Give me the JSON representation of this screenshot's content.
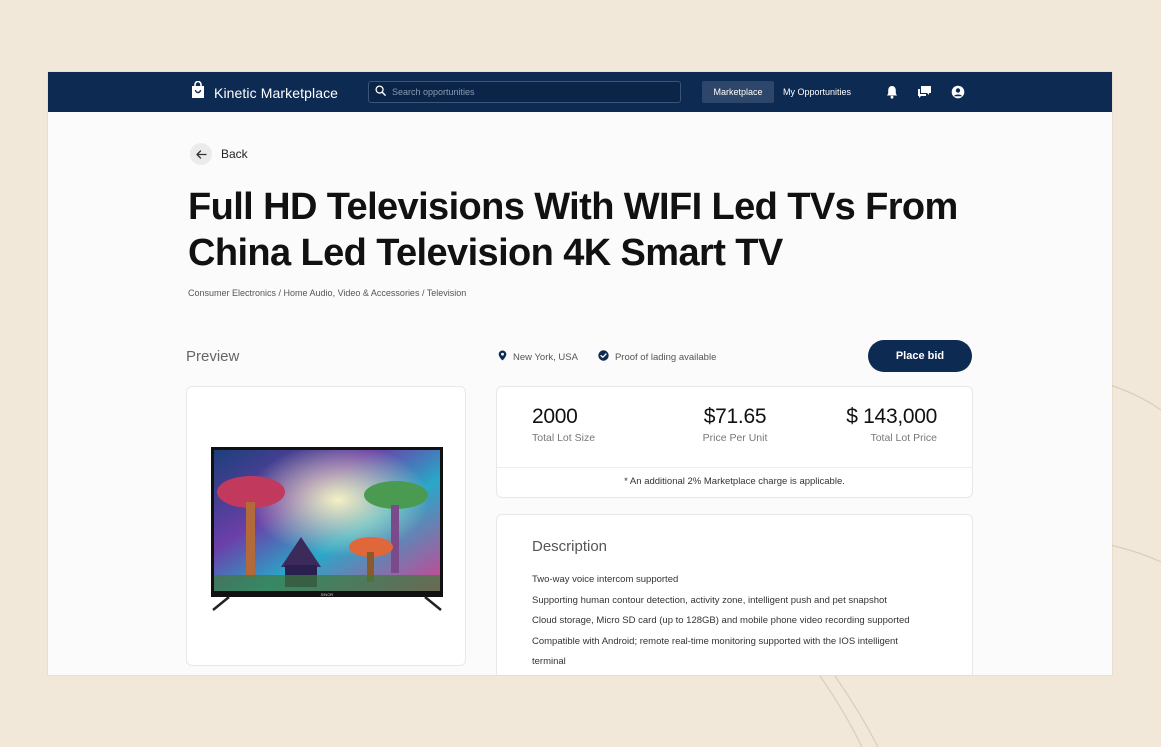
{
  "app": {
    "name": "Kinetic Marketplace"
  },
  "search": {
    "placeholder": "Search opportunities"
  },
  "nav": {
    "marketplace": "Marketplace",
    "my_opportunities": "My Opportunities"
  },
  "icons": {
    "logo": "shopping-bag-icon",
    "search": "search-icon",
    "notifications": "bell-icon",
    "messages": "chat-icon",
    "account": "user-circle-icon",
    "back": "arrow-left-icon",
    "location": "location-pin-icon",
    "verified": "check-circle-icon"
  },
  "back": {
    "label": "Back"
  },
  "product": {
    "title": "Full HD Televisions With WIFI Led TVs From China Led Television 4K Smart TV",
    "breadcrumb": "Consumer Electronics / Home Audio, Video & Accessories /  Television",
    "location": "New York, USA",
    "proof": "Proof of lading available",
    "tv_brand": "SINOR"
  },
  "preview": {
    "label": "Preview"
  },
  "actions": {
    "place_bid": "Place bid"
  },
  "stats": {
    "lot_size": {
      "value": "2000",
      "label": "Total Lot Size"
    },
    "price_per_unit": {
      "value": "$71.65",
      "label": "Price Per Unit"
    },
    "total_price": {
      "value": "$ 143,000",
      "label": "Total Lot Price"
    },
    "note": "* An additional 2% Marketplace charge is applicable."
  },
  "description": {
    "title": "Description",
    "lines": [
      "Two-way voice intercom supported",
      "Supporting human contour detection, activity zone, intelligent push and pet snapshot",
      "Cloud storage, Micro SD card (up to 128GB) and mobile phone video recording supported",
      "Compatible with Android; remote real-time monitoring supported with the IOS intelligent",
      "terminal"
    ]
  },
  "colors": {
    "navy": "#0d2a52",
    "background": "#f2e8da",
    "surface": "#fbfbfb",
    "card": "#ffffff"
  }
}
